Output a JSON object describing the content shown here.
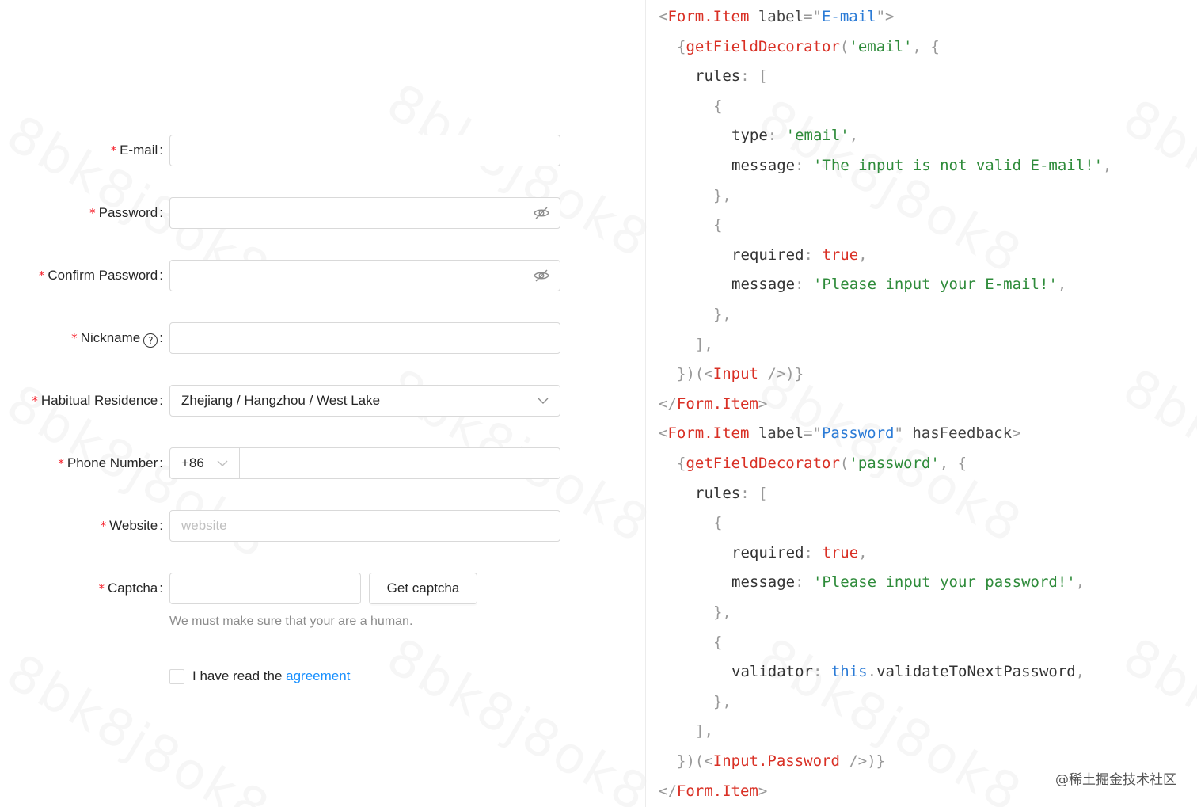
{
  "watermark": "8bk8j8ok8",
  "form": {
    "fields": [
      {
        "label": "E-mail",
        "required": true,
        "value": "",
        "placeholder": ""
      },
      {
        "label": "Password",
        "required": true,
        "value": "",
        "icon": "eye-invisible-icon"
      },
      {
        "label": "Confirm Password",
        "required": true,
        "value": "",
        "icon": "eye-invisible-icon"
      },
      {
        "label": "Nickname",
        "required": true,
        "value": "",
        "help_icon": "question-circle-icon"
      },
      {
        "label": "Habitual Residence",
        "required": true,
        "value": "Zhejiang / Hangzhou / West Lake",
        "icon": "chevron-down-icon"
      },
      {
        "label": "Phone Number",
        "required": true,
        "prefix": "+86",
        "value": ""
      },
      {
        "label": "Website",
        "required": true,
        "value": "",
        "placeholder": "website"
      },
      {
        "label": "Captcha",
        "required": true,
        "value": "",
        "button": "Get captcha"
      }
    ],
    "colon": ":",
    "captcha_extra": "We must make sure that your are a human.",
    "agreement": {
      "text": "I have read the ",
      "link": "agreement",
      "checked": false
    }
  },
  "code": {
    "lines": [
      {
        "indent": 0,
        "tokens": [
          [
            "p",
            "<"
          ],
          [
            "tag",
            "Form.Item"
          ],
          [
            "plain",
            " "
          ],
          [
            "attr",
            "label"
          ],
          [
            "p",
            "=\""
          ],
          [
            "val",
            "E-mail"
          ],
          [
            "p",
            "\">"
          ]
        ]
      },
      {
        "indent": 1,
        "tokens": [
          [
            "p",
            "{"
          ],
          [
            "fn",
            "getFieldDecorator"
          ],
          [
            "p",
            "("
          ],
          [
            "str",
            "'email'"
          ],
          [
            "p",
            ", {"
          ]
        ]
      },
      {
        "indent": 2,
        "tokens": [
          [
            "key",
            "rules"
          ],
          [
            "p",
            ": ["
          ]
        ]
      },
      {
        "indent": 3,
        "tokens": [
          [
            "p",
            "{"
          ]
        ]
      },
      {
        "indent": 4,
        "tokens": [
          [
            "key",
            "type"
          ],
          [
            "p",
            ": "
          ],
          [
            "str",
            "'email'"
          ],
          [
            "p",
            ","
          ]
        ]
      },
      {
        "indent": 4,
        "tokens": [
          [
            "key",
            "message"
          ],
          [
            "p",
            ": "
          ],
          [
            "str",
            "'The input is not valid E-mail!'"
          ],
          [
            "p",
            ","
          ]
        ]
      },
      {
        "indent": 3,
        "tokens": [
          [
            "p",
            "},"
          ]
        ]
      },
      {
        "indent": 3,
        "tokens": [
          [
            "p",
            "{"
          ]
        ]
      },
      {
        "indent": 4,
        "tokens": [
          [
            "key",
            "required"
          ],
          [
            "p",
            ": "
          ],
          [
            "bool",
            "true"
          ],
          [
            "p",
            ","
          ]
        ]
      },
      {
        "indent": 4,
        "tokens": [
          [
            "key",
            "message"
          ],
          [
            "p",
            ": "
          ],
          [
            "str",
            "'Please input your E-mail!'"
          ],
          [
            "p",
            ","
          ]
        ]
      },
      {
        "indent": 3,
        "tokens": [
          [
            "p",
            "},"
          ]
        ]
      },
      {
        "indent": 2,
        "tokens": [
          [
            "p",
            "],"
          ]
        ]
      },
      {
        "indent": 1,
        "tokens": [
          [
            "p",
            "})(<"
          ],
          [
            "tag",
            "Input"
          ],
          [
            "p",
            " />)}"
          ]
        ]
      },
      {
        "indent": 0,
        "tokens": [
          [
            "p",
            "</"
          ],
          [
            "tag",
            "Form.Item"
          ],
          [
            "p",
            ">"
          ]
        ]
      },
      {
        "indent": 0,
        "tokens": [
          [
            "p",
            "<"
          ],
          [
            "tag",
            "Form.Item"
          ],
          [
            "plain",
            " "
          ],
          [
            "attr",
            "label"
          ],
          [
            "p",
            "=\""
          ],
          [
            "val",
            "Password"
          ],
          [
            "p",
            "\" "
          ],
          [
            "attr",
            "hasFeedback"
          ],
          [
            "p",
            ">"
          ]
        ]
      },
      {
        "indent": 1,
        "tokens": [
          [
            "p",
            "{"
          ],
          [
            "fn",
            "getFieldDecorator"
          ],
          [
            "p",
            "("
          ],
          [
            "str",
            "'password'"
          ],
          [
            "p",
            ", {"
          ]
        ]
      },
      {
        "indent": 2,
        "tokens": [
          [
            "key",
            "rules"
          ],
          [
            "p",
            ": ["
          ]
        ]
      },
      {
        "indent": 3,
        "tokens": [
          [
            "p",
            "{"
          ]
        ]
      },
      {
        "indent": 4,
        "tokens": [
          [
            "key",
            "required"
          ],
          [
            "p",
            ": "
          ],
          [
            "bool",
            "true"
          ],
          [
            "p",
            ","
          ]
        ]
      },
      {
        "indent": 4,
        "tokens": [
          [
            "key",
            "message"
          ],
          [
            "p",
            ": "
          ],
          [
            "str",
            "'Please input your password!'"
          ],
          [
            "p",
            ","
          ]
        ]
      },
      {
        "indent": 3,
        "tokens": [
          [
            "p",
            "},"
          ]
        ]
      },
      {
        "indent": 3,
        "tokens": [
          [
            "p",
            "{"
          ]
        ]
      },
      {
        "indent": 4,
        "tokens": [
          [
            "key",
            "validator"
          ],
          [
            "p",
            ": "
          ],
          [
            "kw",
            "this"
          ],
          [
            "p",
            "."
          ],
          [
            "plain",
            "validateToNextPassword"
          ],
          [
            "p",
            ","
          ]
        ]
      },
      {
        "indent": 3,
        "tokens": [
          [
            "p",
            "},"
          ]
        ]
      },
      {
        "indent": 2,
        "tokens": [
          [
            "p",
            "],"
          ]
        ]
      },
      {
        "indent": 1,
        "tokens": [
          [
            "p",
            "})(<"
          ],
          [
            "tag",
            "Input.Password"
          ],
          [
            "p",
            " />)}"
          ]
        ]
      },
      {
        "indent": 0,
        "tokens": [
          [
            "p",
            "</"
          ],
          [
            "tag",
            "Form.Item"
          ],
          [
            "p",
            ">"
          ]
        ]
      }
    ]
  },
  "credit": "@稀土掘金技术社区"
}
